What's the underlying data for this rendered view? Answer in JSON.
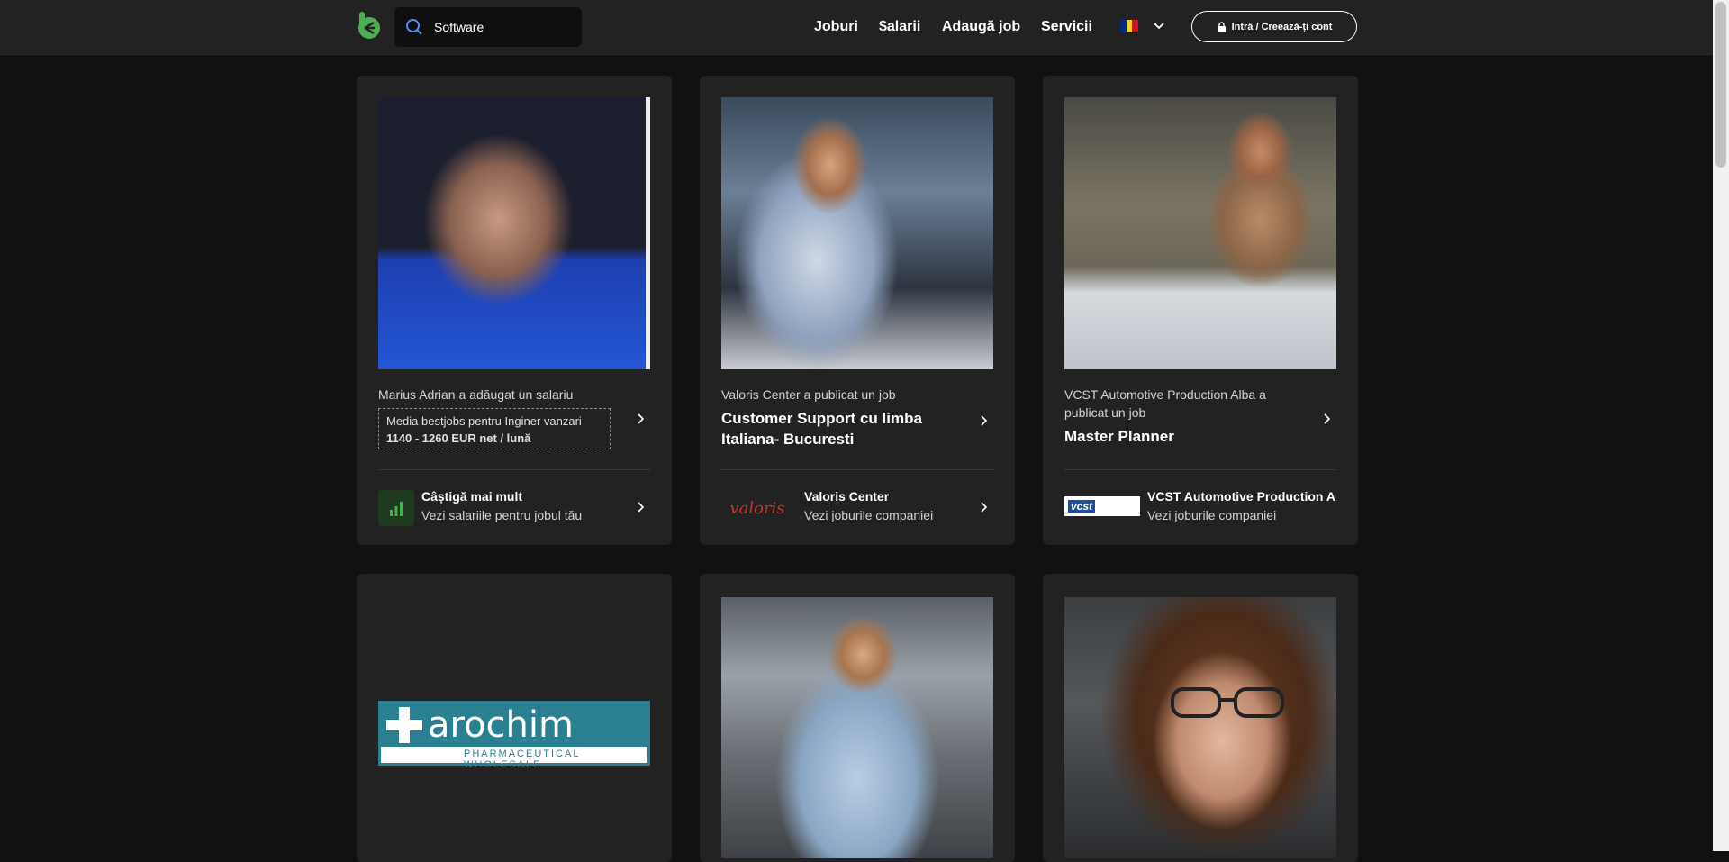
{
  "search": {
    "value": "Software"
  },
  "nav": {
    "jobs": "Joburi",
    "salaries": "$alarii",
    "add_job": "Adaugă job",
    "services": "Servicii"
  },
  "login": {
    "label": "Intră / Creează-ți cont"
  },
  "colors": {
    "accent": "#4caf50",
    "background": "#111111",
    "card": "#222222"
  },
  "cards": [
    {
      "meta": "Marius Adrian a adăugat un salariu",
      "salary_line": "Media bestjobs pentru Inginer vanzari",
      "salary_value": "1140 - 1260 EUR net / lună",
      "footer_title": "Câștigă mai mult",
      "footer_sub": "Vezi salariile pentru jobul tău"
    },
    {
      "meta": "Valoris Center a publicat un job",
      "title": "Customer Support cu limba Italiana- Bucuresti",
      "logo_text": "valoris",
      "footer_title": "Valoris Center",
      "footer_sub": "Vezi joburile companiei"
    },
    {
      "meta": "VCST Automotive Production Alba a publicat un job",
      "title": "Master Planner",
      "logo_text": "vcst",
      "footer_title": "VCST Automotive Production Alba",
      "footer_sub": "Vezi joburile companiei"
    },
    {
      "logo_main": "arochim",
      "logo_sub": "PHARMACEUTICAL WHOLESALE"
    },
    {},
    {}
  ]
}
